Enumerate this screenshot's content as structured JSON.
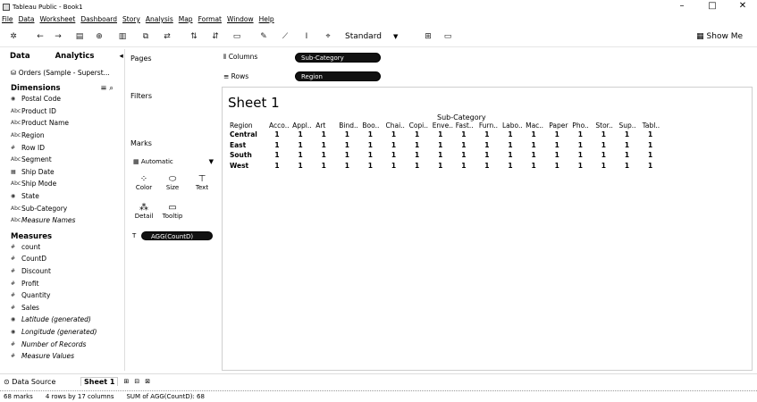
{
  "window": {
    "title": "Tableau Public - Book1"
  },
  "menu": [
    "File",
    "Data",
    "Worksheet",
    "Dashboard",
    "Story",
    "Analysis",
    "Map",
    "Format",
    "Window",
    "Help"
  ],
  "toolbar": {
    "fit_select": "Standard",
    "show_me": "Show Me"
  },
  "data_pane": {
    "tab_data": "Data",
    "tab_analytics": "Analytics",
    "datasource": "Orders (Sample - Superst...",
    "dimensions_header": "Dimensions",
    "dimensions": [
      {
        "label": "Postal Code",
        "icon": "globe-icon"
      },
      {
        "label": "Product ID",
        "icon": "abc-icon"
      },
      {
        "label": "Product Name",
        "icon": "abc-icon"
      },
      {
        "label": "Region",
        "icon": "abc-icon"
      },
      {
        "label": "Row ID",
        "icon": "number-icon"
      },
      {
        "label": "Segment",
        "icon": "abc-icon"
      },
      {
        "label": "Ship Date",
        "icon": "calendar-icon"
      },
      {
        "label": "Ship Mode",
        "icon": "abc-icon"
      },
      {
        "label": "State",
        "icon": "globe-icon"
      },
      {
        "label": "Sub-Category",
        "icon": "abc-icon"
      },
      {
        "label": "Measure Names",
        "icon": "abc-icon"
      }
    ],
    "measures_header": "Measures",
    "measures": [
      {
        "label": "count",
        "icon": "number-icon"
      },
      {
        "label": "CountD",
        "icon": "number-icon"
      },
      {
        "label": "Discount",
        "icon": "number-icon"
      },
      {
        "label": "Profit",
        "icon": "number-icon"
      },
      {
        "label": "Quantity",
        "icon": "number-icon"
      },
      {
        "label": "Sales",
        "icon": "number-icon"
      },
      {
        "label": "Latitude (generated)",
        "icon": "globe-icon"
      },
      {
        "label": "Longitude (generated)",
        "icon": "globe-icon"
      },
      {
        "label": "Number of Records",
        "icon": "number-icon"
      },
      {
        "label": "Measure Values",
        "icon": "number-icon"
      }
    ]
  },
  "cards": {
    "pages": "Pages",
    "filters": "Filters",
    "marks": "Marks",
    "marks_type": "Automatic",
    "mark_buttons": [
      "Color",
      "Size",
      "Text",
      "Detail",
      "Tooltip"
    ],
    "mark_pill": "AGG(CountD)"
  },
  "shelves": {
    "columns_label": "Columns",
    "columns_pill": "Sub-Category",
    "rows_label": "Rows",
    "rows_pill": "Region"
  },
  "sheet": {
    "title": "Sheet 1",
    "column_field": "Sub-Category",
    "row_field": "Region",
    "columns": [
      "Acco..",
      "Appl..",
      "Art",
      "Bind..",
      "Boo..",
      "Chai..",
      "Copi..",
      "Enve..",
      "Fast..",
      "Furn..",
      "Labo..",
      "Mac..",
      "Paper",
      "Pho..",
      "Stor..",
      "Sup..",
      "Tabl.."
    ],
    "rows": [
      {
        "region": "Central",
        "values": [
          "1",
          "1",
          "1",
          "1",
          "1",
          "1",
          "1",
          "1",
          "1",
          "1",
          "1",
          "1",
          "1",
          "1",
          "1",
          "1",
          "1"
        ]
      },
      {
        "region": "East",
        "values": [
          "1",
          "1",
          "1",
          "1",
          "1",
          "1",
          "1",
          "1",
          "1",
          "1",
          "1",
          "1",
          "1",
          "1",
          "1",
          "1",
          "1"
        ]
      },
      {
        "region": "South",
        "values": [
          "1",
          "1",
          "1",
          "1",
          "1",
          "1",
          "1",
          "1",
          "1",
          "1",
          "1",
          "1",
          "1",
          "1",
          "1",
          "1",
          "1"
        ]
      },
      {
        "region": "West",
        "values": [
          "1",
          "1",
          "1",
          "1",
          "1",
          "1",
          "1",
          "1",
          "1",
          "1",
          "1",
          "1",
          "1",
          "1",
          "1",
          "1",
          "1"
        ]
      }
    ]
  },
  "tabs": {
    "data_source": "Data Source",
    "sheet": "Sheet 1"
  },
  "status": {
    "marks": "68 marks",
    "dims": "4 rows by 17 columns",
    "sum": "SUM of AGG(CountD): 68"
  }
}
